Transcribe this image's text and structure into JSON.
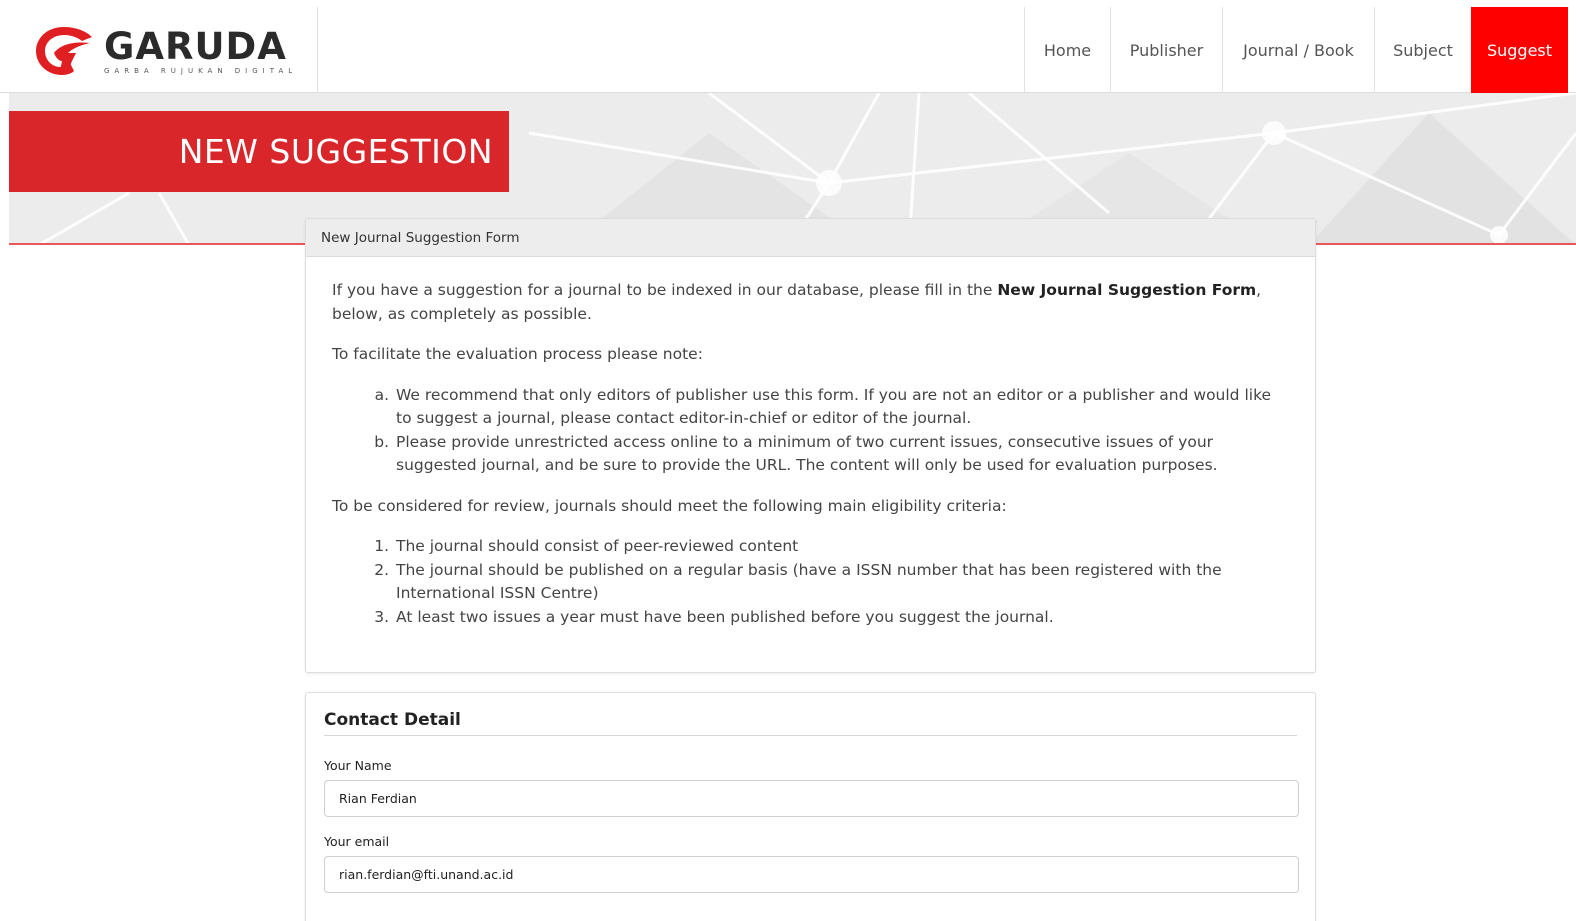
{
  "brand": {
    "name": "GARUDA",
    "tagline": "GARBA RUJUKAN DIGITAL"
  },
  "nav": {
    "items": [
      {
        "label": "Home"
      },
      {
        "label": "Publisher"
      },
      {
        "label": "Journal / Book"
      },
      {
        "label": "Subject"
      },
      {
        "label": "Suggest",
        "active": true
      }
    ]
  },
  "hero": {
    "title": "NEW SUGGESTION"
  },
  "intro_panel": {
    "heading": "New Journal Suggestion Form",
    "p1_before": "If you have a suggestion for a journal to be indexed in our database, please fill in the ",
    "p1_bold": "New Journal Suggestion Form",
    "p1_after": ", below, as completely as possible.",
    "p2": "To facilitate the evaluation process please note:",
    "notes": [
      "We recommend that only editors of publisher use this form. If you are not an editor or a publisher and would like to suggest a journal, please contact editor-in-chief or editor of the journal.",
      "Please provide unrestricted access online to a minimum of two current issues, consecutive issues of your suggested journal, and be sure to provide the URL. The content will only be used for evaluation purposes."
    ],
    "p3": "To be considered for review, journals should meet the following main eligibility criteria:",
    "criteria": [
      "The journal should consist of peer-reviewed content",
      "The journal should be published on a regular basis (have a ISSN number that has been registered with the International ISSN Centre)",
      "At least two issues a year must have been published before you suggest the journal."
    ]
  },
  "contact": {
    "title": "Contact Detail",
    "name_label": "Your Name",
    "name_value": "Rian Ferdian",
    "email_label": "Your email",
    "email_value": "rian.ferdian@fti.unand.ac.id"
  },
  "colors": {
    "brand_red": "#d9262a",
    "active_nav": "#ff0000"
  }
}
